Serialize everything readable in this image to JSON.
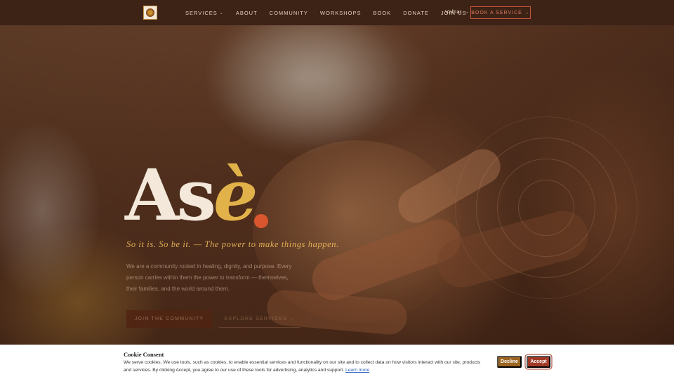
{
  "nav": {
    "logo_icon": "organization-emblem-icon",
    "links": [
      {
        "label": "SERVICES",
        "has_dropdown": true
      },
      {
        "label": "ABOUT"
      },
      {
        "label": "COMMUNITY"
      },
      {
        "label": "WORKSHOPS"
      },
      {
        "label": "BOOK"
      },
      {
        "label": "DONATE"
      },
      {
        "label": "JOIN US"
      }
    ],
    "dropdown_icon": "chevron-down-icon",
    "language_label": "Valhar →",
    "book_button": "BOOK A SERVICE →"
  },
  "hero": {
    "title_main": "As",
    "title_accent": "è",
    "tagline": "So it is. So be it. — The power to make things happen.",
    "intro": "We are a community rooted in healing, dignity, and purpose. Every person carries within them the power to transform — themselves, their families, and the world around them.",
    "cta_primary": "JOIN THE COMMUNITY",
    "cta_secondary": "EXPLORE SERVICES →"
  },
  "cookie": {
    "title": "Cookie Consent",
    "text": "We serve cookies. We use tools, such as cookies, to enable essential services and functionality on our site and to collect data on how visitors interact with our site, products and services. By clicking Accept, you agree to our use of these tools for advertising, analytics and support.",
    "learn_more": "Learn more",
    "decline_label": "Decline",
    "accept_label": "Accept"
  },
  "colors": {
    "nav_bg": "#3d2216",
    "title": "#f3e8da",
    "accent_gold": "#e2b24a",
    "accent_orange": "#d9562f",
    "decline_bg": "#9c6520",
    "accept_bg": "#a23a26"
  }
}
